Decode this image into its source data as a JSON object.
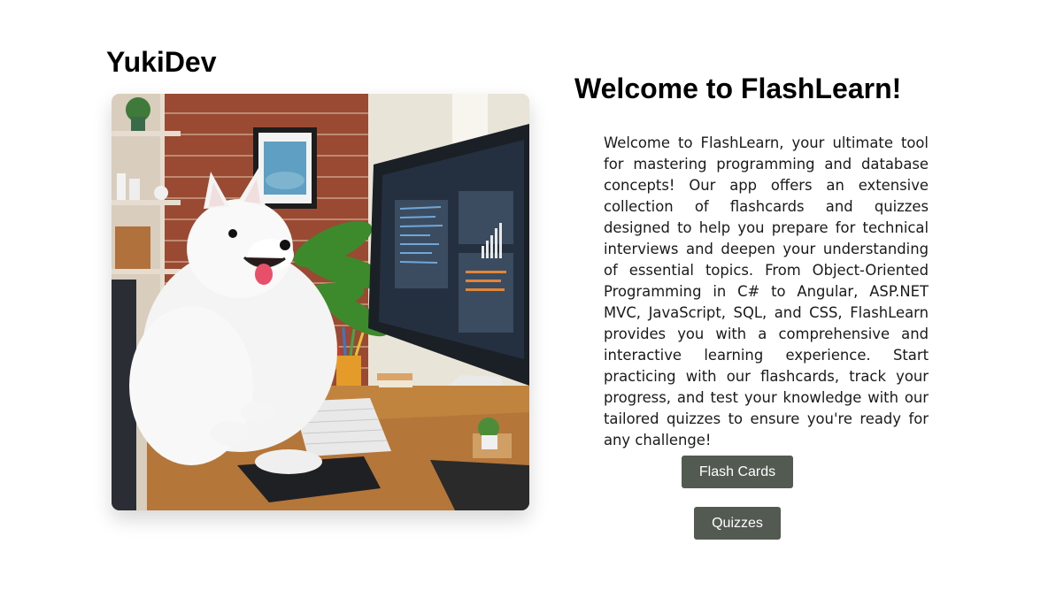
{
  "header": {
    "brand": "YukiDev"
  },
  "hero": {
    "image_icon": "dog-at-computer-illustration",
    "title": "Welcome to FlashLearn!",
    "description": "Welcome to FlashLearn, your ultimate tool for mastering programming and database concepts! Our app offers an extensive collection of flashcards and quizzes designed to help you prepare for technical interviews and deepen your understanding of essential topics. From Object-Oriented Programming in C# to Angular, ASP.NET MVC, JavaScript, SQL, and CSS, FlashLearn provides you with a comprehensive and interactive learning experience. Start practicing with our flashcards, track your progress, and test your knowledge with our tailored quizzes to ensure you're ready for any challenge!"
  },
  "actions": {
    "flash_cards_label": "Flash Cards",
    "quizzes_label": "Quizzes"
  },
  "colors": {
    "button_bg": "#535a52",
    "button_text": "#ffffff"
  }
}
